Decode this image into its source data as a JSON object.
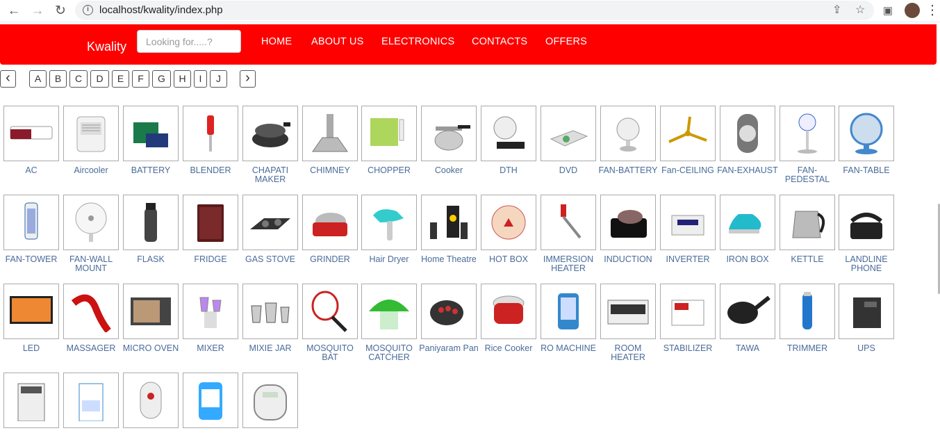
{
  "browser": {
    "url": "localhost/kwality/index.php",
    "back_icon": "←",
    "forward_icon": "→",
    "reload_icon": "↻",
    "share_icon": "⇪",
    "star_icon": "☆",
    "sidebar_icon": "▣",
    "menu_icon": "⋮",
    "info_icon": "i"
  },
  "navbar": {
    "brand": "Kwality",
    "search_placeholder": "Looking for.....?",
    "items": [
      "HOME",
      "ABOUT US",
      "ELECTRONICS",
      "CONTACTS",
      "OFFERS"
    ],
    "color": "#ff0000"
  },
  "alphabet": {
    "prev": "‹",
    "next": "›",
    "letters": [
      "A",
      "B",
      "C",
      "D",
      "E",
      "F",
      "G",
      "H",
      "I",
      "J"
    ]
  },
  "products": [
    "AC",
    "Aircooler",
    "BATTERY",
    "BLENDER",
    "CHAPATI MAKER",
    "CHIMNEY",
    "CHOPPER",
    "Cooker",
    "DTH",
    "DVD",
    "FAN-BATTERY",
    "Fan-CEILING",
    "FAN-EXHAUST",
    "FAN-PEDESTAL",
    "FAN-TABLE",
    "FAN-TOWER",
    "FAN-WALL MOUNT",
    "FLASK",
    "FRIDGE",
    "GAS STOVE",
    "GRINDER",
    "Hair Dryer",
    "Home Theatre",
    "HOT BOX",
    "IMMERSION HEATER",
    "INDUCTION",
    "INVERTER",
    "IRON BOX",
    "KETTLE",
    "LANDLINE PHONE",
    "LED",
    "MASSAGER",
    "MICRO OVEN",
    "MIXER",
    "MIXIE JAR",
    "MOSQUITO BAT",
    "MOSQUITO CATCHER",
    "Paniyaram Pan",
    "Rice Cooker",
    "RO MACHINE",
    "ROOM HEATER",
    "STABILIZER",
    "TAWA",
    "TRIMMER",
    "UPS",
    "",
    "",
    "",
    "",
    ""
  ],
  "icons": [
    "ac-icon",
    "aircooler-icon",
    "battery-icon",
    "blender-icon",
    "chapati-maker-icon",
    "chimney-icon",
    "chopper-icon",
    "cooker-icon",
    "dth-icon",
    "dvd-icon",
    "fan-battery-icon",
    "fan-ceiling-icon",
    "fan-exhaust-icon",
    "fan-pedestal-icon",
    "fan-table-icon",
    "fan-tower-icon",
    "fan-wall-mount-icon",
    "flask-icon",
    "fridge-icon",
    "gas-stove-icon",
    "grinder-icon",
    "hair-dryer-icon",
    "home-theatre-icon",
    "hot-box-icon",
    "immersion-heater-icon",
    "induction-icon",
    "inverter-icon",
    "iron-box-icon",
    "kettle-icon",
    "landline-phone-icon",
    "led-icon",
    "massager-icon",
    "micro-oven-icon",
    "mixer-icon",
    "mixie-jar-icon",
    "mosquito-bat-icon",
    "mosquito-catcher-icon",
    "paniyaram-pan-icon",
    "rice-cooker-icon",
    "ro-machine-icon",
    "room-heater-icon",
    "stabilizer-icon",
    "tawa-icon",
    "trimmer-icon",
    "ups-icon",
    "washing-machine-icon",
    "water-dispenser-icon",
    "water-heater-icon",
    "water-purifier-icon",
    "weighing-scale-icon"
  ]
}
